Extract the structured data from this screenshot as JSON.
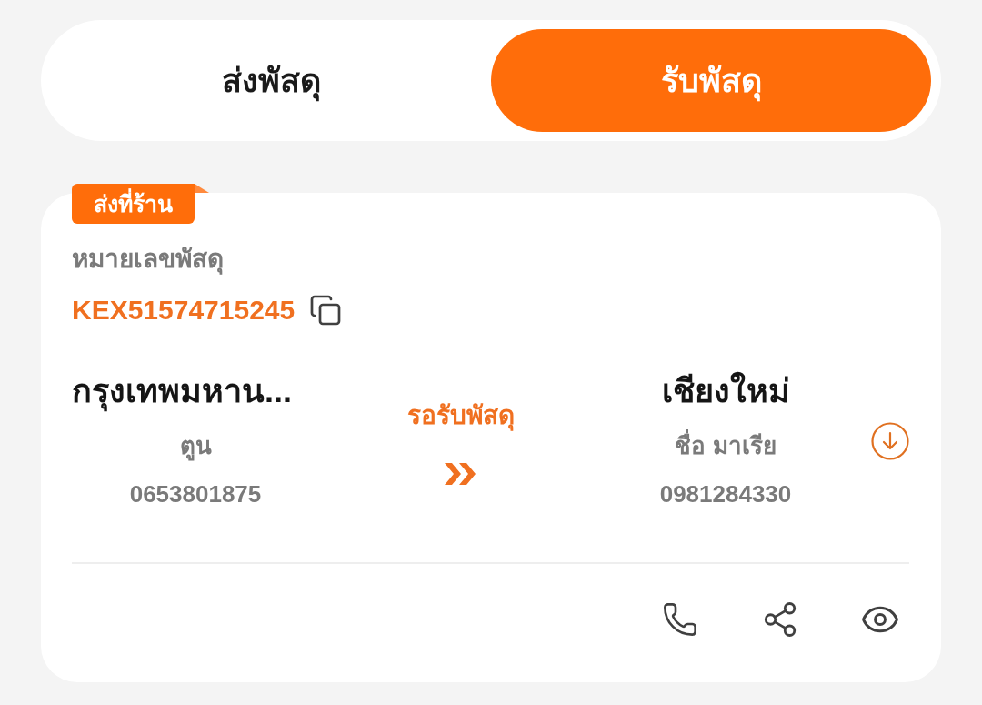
{
  "tabs": [
    {
      "label": "ส่งพัสดุ",
      "selected": false
    },
    {
      "label": "รับพัสดุ",
      "selected": true
    }
  ],
  "parcel": {
    "tag": "ส่งที่ร้าน",
    "tracking_label": "หมายเลขพัสดุ",
    "tracking_number": "KEX51574715245",
    "origin": {
      "city": "กรุงเทพมหาน...",
      "name": "ตูน",
      "phone": "0653801875"
    },
    "status": "รอรับพัสดุ",
    "destination": {
      "city": "เชียงใหม่",
      "name": "ชื่อ มาเรีย",
      "phone": "0981284330"
    }
  }
}
